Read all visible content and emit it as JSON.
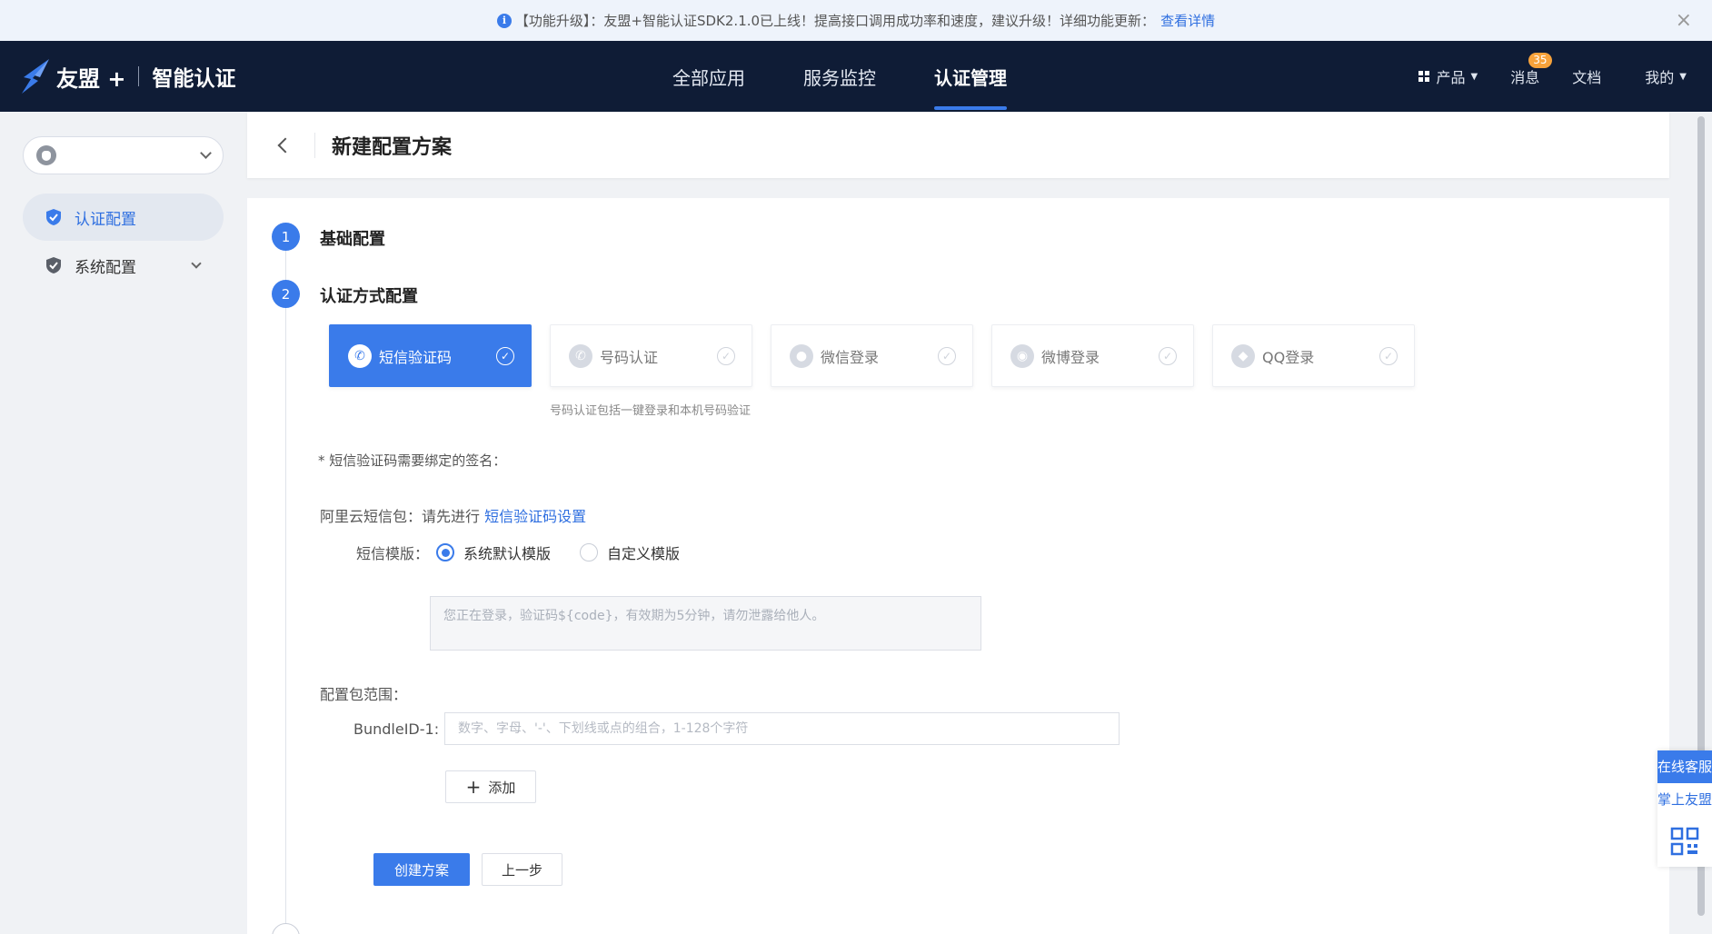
{
  "banner": {
    "text": "【功能升级】：友盟+智能认证SDK2.1.0已上线！提高接口调用成功率和速度，建议升级！详细功能更新：",
    "link": "查看详情",
    "close": "×"
  },
  "header": {
    "brand": "友盟 +",
    "product": "智能认证",
    "nav": [
      "全部应用",
      "服务监控",
      "认证管理"
    ],
    "right": {
      "product_menu": "产品",
      "messages": "消息",
      "messages_badge": "35",
      "docs": "文档",
      "mine": "我的"
    }
  },
  "sidebar": {
    "items": [
      {
        "label": "认证配置",
        "active": true
      },
      {
        "label": "系统配置",
        "active": false
      }
    ]
  },
  "page": {
    "title": "新建配置方案"
  },
  "steps": [
    {
      "num": "1",
      "label": "基础配置"
    },
    {
      "num": "2",
      "label": "认证方式配置"
    }
  ],
  "auth_methods": [
    {
      "label": "短信验证码",
      "active": true
    },
    {
      "label": "号码认证",
      "active": false
    },
    {
      "label": "微信登录",
      "active": false
    },
    {
      "label": "微博登录",
      "active": false
    },
    {
      "label": "QQ登录",
      "active": false
    }
  ],
  "auth_hint": "号码认证包括一键登录和本机号码验证",
  "sms": {
    "signature_label": "* 短信验证码需要绑定的签名：",
    "aliyun_label": "阿里云短信包：请先进行",
    "aliyun_link": "短信验证码设置",
    "template_label": "短信模版：",
    "template_options": [
      "系统默认模版",
      "自定义模版"
    ],
    "template_selected": 0,
    "template_text": "您正在登录，验证码${code}，有效期为5分钟，请勿泄露给他人。"
  },
  "bundle": {
    "scope_label": "配置包范围：",
    "id_label": "BundleID-1:",
    "placeholder": "数字、字母、'-'、下划线或点的组合，1-128个字符",
    "add_label": "添加"
  },
  "actions": {
    "create": "创建方案",
    "prev": "上一步"
  },
  "float": {
    "service": "在线客服",
    "app": "掌上友盟"
  },
  "colors": {
    "accent": "#3a7bea",
    "header_bg": "#0f1c36",
    "badge": "#f7a23b"
  }
}
